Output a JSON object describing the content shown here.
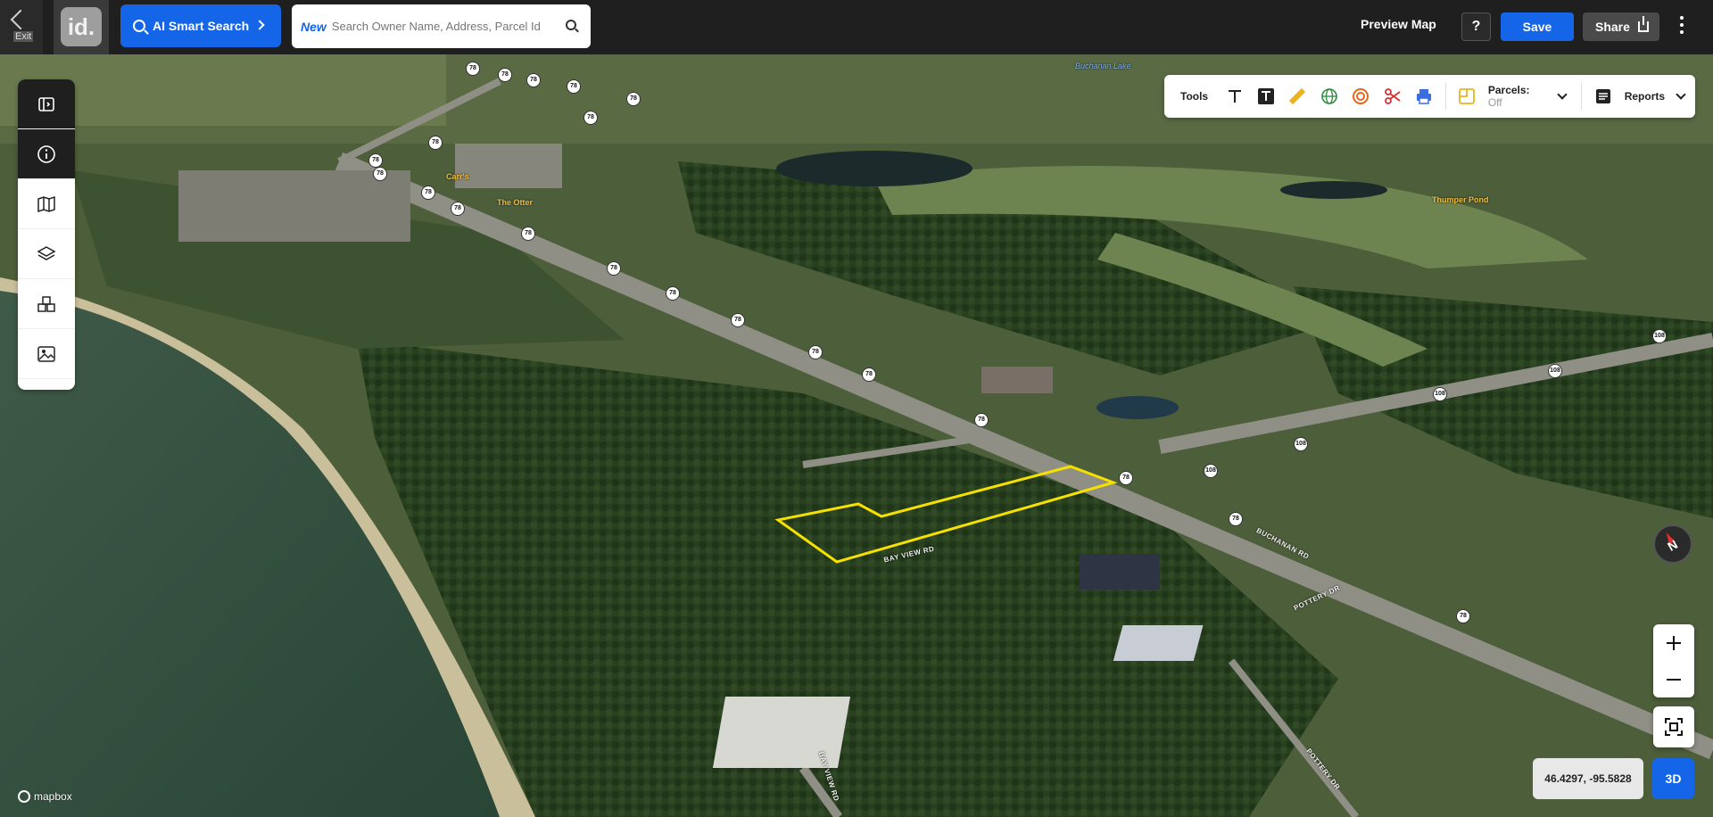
{
  "topbar": {
    "exit_label": "Exit",
    "logo_text": "id.",
    "ai_search_label": "AI Smart Search",
    "search_new_tag": "New",
    "search_placeholder": "Search Owner Name, Address, Parcel Id",
    "preview_map_label": "Preview Map",
    "help_label": "?",
    "save_label": "Save",
    "share_label": "Share"
  },
  "tools_bar": {
    "tools_label": "Tools",
    "icons": [
      "text-icon",
      "text-box-icon",
      "ruler-icon",
      "globe-measure-icon",
      "radius-icon",
      "scissors-icon",
      "print-icon"
    ],
    "parcels_label": "Parcels:",
    "parcels_state": "Off",
    "reports_label": "Reports"
  },
  "left_tools": [
    "panel-toggle-icon",
    "info-icon",
    "map-icon",
    "layers-icon",
    "buildings-icon",
    "image-icon"
  ],
  "map": {
    "labels": {
      "buchanan_lake": "Buchanan Lake",
      "thumper_pond": "Thumper Pond",
      "the_otter": "The Otter",
      "carrs": "Carr's",
      "bay_view_rd": "BAY VIEW RD",
      "bay_view_rd_2": "BAY VIEW RD",
      "buchanan_rd": "BUCHANAN RD",
      "pottery_dr": "POTTERY DR",
      "pottery_dr_2": "POTTERY DR"
    },
    "shields": {
      "r78": "78",
      "r108": "108"
    }
  },
  "coordinates": "46.4297, -95.5828",
  "view_mode": "3D",
  "attribution": "mapbox",
  "colors": {
    "accent": "#1565e8",
    "parcel_outline": "#f5e000",
    "topbar_bg": "#1f1f1f"
  }
}
